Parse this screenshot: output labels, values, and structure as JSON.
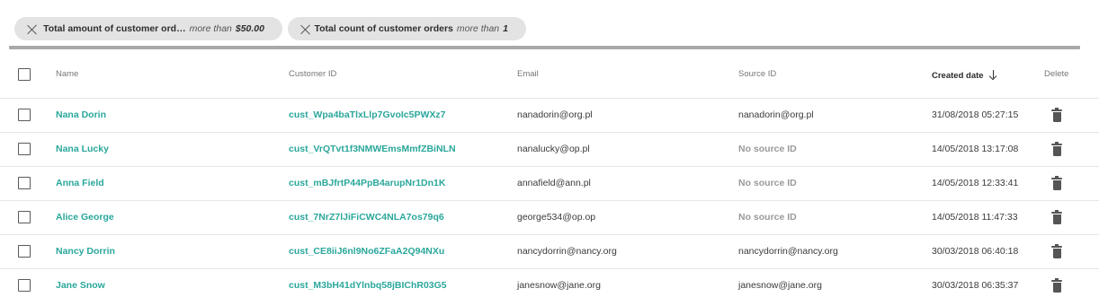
{
  "filters": [
    {
      "label": "Total amount of customer ord…",
      "operator": "more than",
      "value": "$50.00"
    },
    {
      "label": "Total count of customer orders",
      "operator": "more than",
      "value": "1"
    }
  ],
  "table": {
    "headers": {
      "name": "Name",
      "customer_id": "Customer ID",
      "email": "Email",
      "source_id": "Source ID",
      "created_date": "Created date",
      "delete": "Delete"
    },
    "sort": {
      "column": "created_date",
      "direction": "descending"
    },
    "rows": [
      {
        "name": "Nana Dorin",
        "customer_id": "cust_Wpa4baTlxLlp7GvoIc5PWXz7",
        "email": "nanadorin@org.pl",
        "source_id": "nanadorin@org.pl",
        "created_date": "31/08/2018 05:27:15"
      },
      {
        "name": "Nana Lucky",
        "customer_id": "cust_VrQTvt1f3NMWEmsMmfZBiNLN",
        "email": "nanalucky@op.pl",
        "source_id": "No source ID",
        "created_date": "14/05/2018 13:17:08"
      },
      {
        "name": "Anna Field",
        "customer_id": "cust_mBJfrtP44PpB4arupNr1Dn1K",
        "email": "annafield@ann.pl",
        "source_id": "No source ID",
        "created_date": "14/05/2018 12:33:41"
      },
      {
        "name": "Alice George",
        "customer_id": "cust_7NrZ7lJiFiCWC4NLA7os79q6",
        "email": "george534@op.op",
        "source_id": "No source ID",
        "created_date": "14/05/2018 11:47:33"
      },
      {
        "name": "Nancy Dorrin",
        "customer_id": "cust_CE8iiJ6nl9No6ZFaA2Q94NXu",
        "email": "nancydorrin@nancy.org",
        "source_id": "nancydorrin@nancy.org",
        "created_date": "30/03/2018 06:40:18"
      },
      {
        "name": "Jane Snow",
        "customer_id": "cust_M3bH41dYlnbq58jBIChR03G5",
        "email": "janesnow@jane.org",
        "source_id": "janesnow@jane.org",
        "created_date": "30/03/2018 06:35:37"
      }
    ]
  },
  "colors": {
    "accent": "#2aa79b",
    "chip_bg": "#e3e3e3",
    "muted": "#9a9a9a"
  },
  "icons": {
    "chip_remove": "close-icon",
    "sort": "arrow-down-icon",
    "row_delete": "trash-icon"
  }
}
